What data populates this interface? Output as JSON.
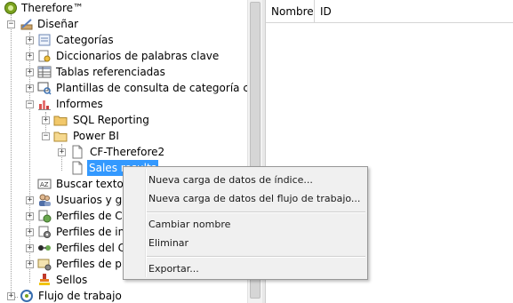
{
  "tree": {
    "root": "Therefore™",
    "disenar": "Diseñar",
    "categorias": "Categorías",
    "diccionarios": "Diccionarios de palabras clave",
    "tablas": "Tablas referenciadas",
    "plantillas": "Plantillas de consulta de categoría cruzada",
    "informes": "Informes",
    "sql": "SQL Reporting",
    "powerbi": "Power BI",
    "cf": "CF-Therefore2",
    "sales": "Sales results",
    "buscar": "Buscar texto c",
    "usuarios": "Usuarios y gru",
    "perfiles_cap": "Perfiles de Cap",
    "perfiles_ind": "Perfiles de ind",
    "perfiles_del": "Perfiles del Co",
    "perfiles_pla": "Perfiles de pla",
    "sellos": "Sellos",
    "flujo": "Flujo de trabajo",
    "expand_plus": "+",
    "expand_minus": "−"
  },
  "list": {
    "col_nombre": "Nombre",
    "col_id": "ID"
  },
  "menu": {
    "item1": "Nueva carga de datos de índice...",
    "item2": "Nueva carga de datos del flujo de trabajo...",
    "item3": "Cambiar nombre",
    "item4": "Eliminar",
    "item5": "Exportar..."
  },
  "colors": {
    "selection": "#3399ff",
    "folder": "#f2c86a",
    "menu_bg": "#f0f0f0"
  }
}
